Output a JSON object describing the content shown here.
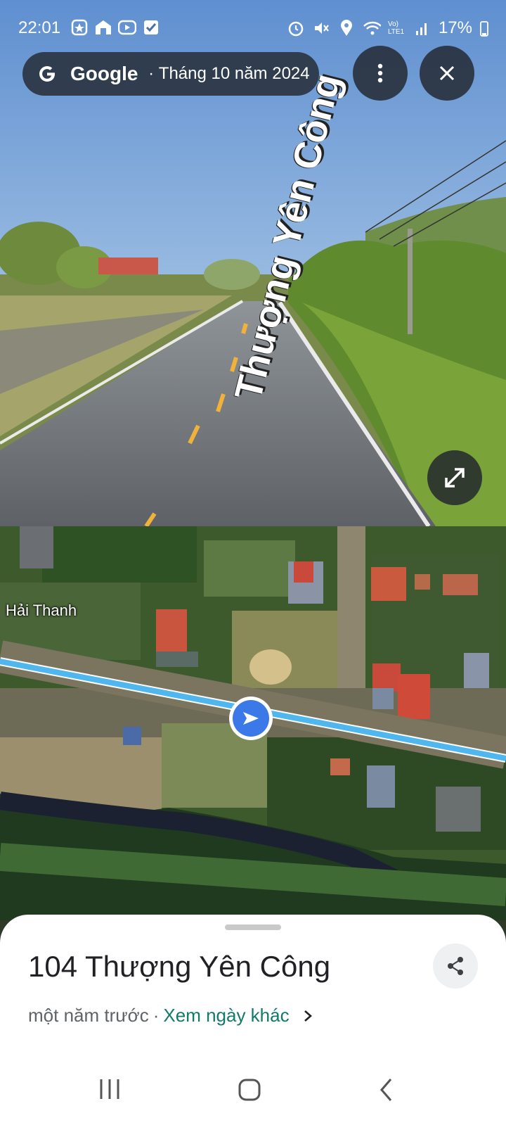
{
  "status_bar": {
    "time": "22:01",
    "battery": "17%",
    "left_icons": [
      "app-icon",
      "home-app-icon",
      "play-icon",
      "check-icon"
    ],
    "right_icons": [
      "alarm-icon",
      "mute-icon",
      "location-icon",
      "wifi-icon",
      "signal-icon",
      "battery-icon"
    ],
    "network_label": "Vo) LTE1"
  },
  "street_view": {
    "brand": "Google",
    "date": "Tháng 10 năm 2024",
    "street_label": "Thượng Yên Công",
    "menu_icon": "more-vert-icon",
    "close_icon": "close-icon",
    "expand_icon": "expand-icon"
  },
  "map": {
    "place_label": "Hải Thanh",
    "route_color": "#4fb7ee",
    "pin_color": "#3b79e8"
  },
  "sheet": {
    "title": "104 Thượng Yên Công",
    "time_ago": "một năm trước",
    "separator": "·",
    "other_dates_link": "Xem ngày khác",
    "share_icon": "share-icon"
  },
  "nav_bar": {
    "icons": [
      "recents-icon",
      "home-icon",
      "back-icon"
    ]
  }
}
